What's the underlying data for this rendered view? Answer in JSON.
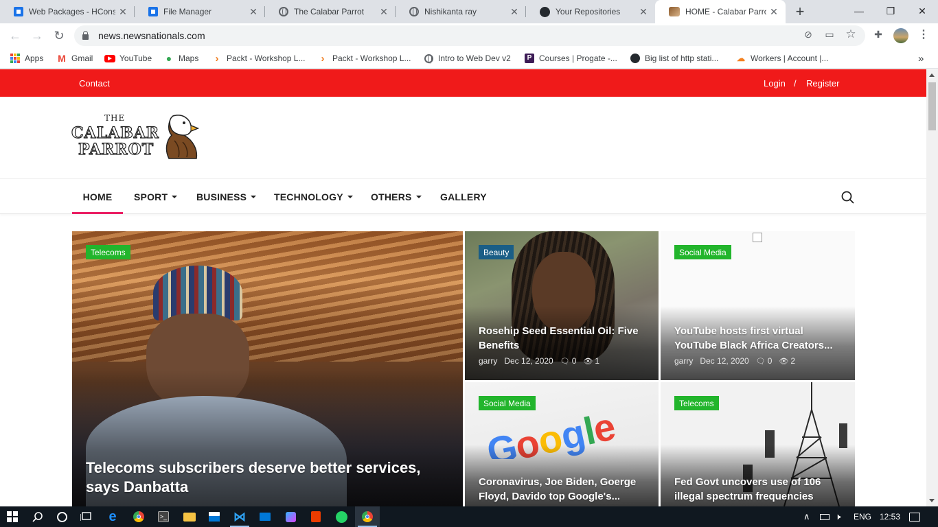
{
  "browser": {
    "tabs": [
      {
        "title": "Web Packages - HCons",
        "icon": "square-doc-icon"
      },
      {
        "title": "File Manager",
        "icon": "square-doc-icon"
      },
      {
        "title": "The Calabar Parrot",
        "icon": "globe-icon"
      },
      {
        "title": "Nishikanta ray",
        "icon": "globe-icon"
      },
      {
        "title": "Your Repositories",
        "icon": "github-icon"
      },
      {
        "title": "HOME - Calabar Parrot",
        "icon": "parrot-icon",
        "active": true
      }
    ],
    "new_tab_label": "+",
    "url": "news.newsnationals.com",
    "bookmarks": [
      {
        "label": "Apps",
        "icon": "apps-grid-icon"
      },
      {
        "label": "Gmail",
        "icon": "gmail-icon"
      },
      {
        "label": "YouTube",
        "icon": "youtube-icon"
      },
      {
        "label": "Maps",
        "icon": "maps-icon"
      },
      {
        "label": "Packt - Workshop L...",
        "icon": "packt-icon"
      },
      {
        "label": "Packt - Workshop L...",
        "icon": "packt-icon"
      },
      {
        "label": "Intro to Web Dev v2",
        "icon": "globe-icon"
      },
      {
        "label": "Courses | Progate -...",
        "icon": "progate-icon"
      },
      {
        "label": "Big list of http stati...",
        "icon": "github-icon"
      },
      {
        "label": "Workers | Account |...",
        "icon": "cloudflare-icon"
      }
    ],
    "more_bookmarks": "»"
  },
  "site": {
    "topbar": {
      "contact": "Contact",
      "login": "Login",
      "separator": "/",
      "register": "Register"
    },
    "logo": {
      "line1": "THE",
      "line2": "CALABAR",
      "line3": "PARROT"
    },
    "nav": [
      {
        "label": "HOME",
        "active": true,
        "dropdown": false
      },
      {
        "label": "SPORT",
        "dropdown": true
      },
      {
        "label": "BUSINESS",
        "dropdown": true
      },
      {
        "label": "TECHNOLOGY",
        "dropdown": true
      },
      {
        "label": "OTHERS",
        "dropdown": true
      },
      {
        "label": "GALLERY",
        "dropdown": false
      }
    ],
    "colors": {
      "topbar": "#f01a1a",
      "nav_active": "#ea1e63",
      "badge_green": "#22b52c",
      "badge_blue": "#1a5e86"
    },
    "posts": [
      {
        "category": "Telecoms",
        "title": "Telecoms subscribers deserve better services, says Danbatta"
      },
      {
        "category": "Beauty",
        "title": "Rosehip Seed Essential Oil: Five Benefits",
        "author": "garry",
        "date": "Dec 12, 2020",
        "comments": "0",
        "views": "1"
      },
      {
        "category": "Social Media",
        "title": "YouTube hosts first virtual YouTube Black Africa Creators...",
        "author": "garry",
        "date": "Dec 12, 2020",
        "comments": "0",
        "views": "2"
      },
      {
        "category": "Social Media",
        "title": "Coronavirus, Joe Biden, Goerge Floyd, Davido top Google's..."
      },
      {
        "category": "Telecoms",
        "title": "Fed Govt uncovers use of 106 illegal spectrum frequencies"
      }
    ]
  },
  "taskbar": {
    "language": "ENG",
    "time": "12:53"
  }
}
